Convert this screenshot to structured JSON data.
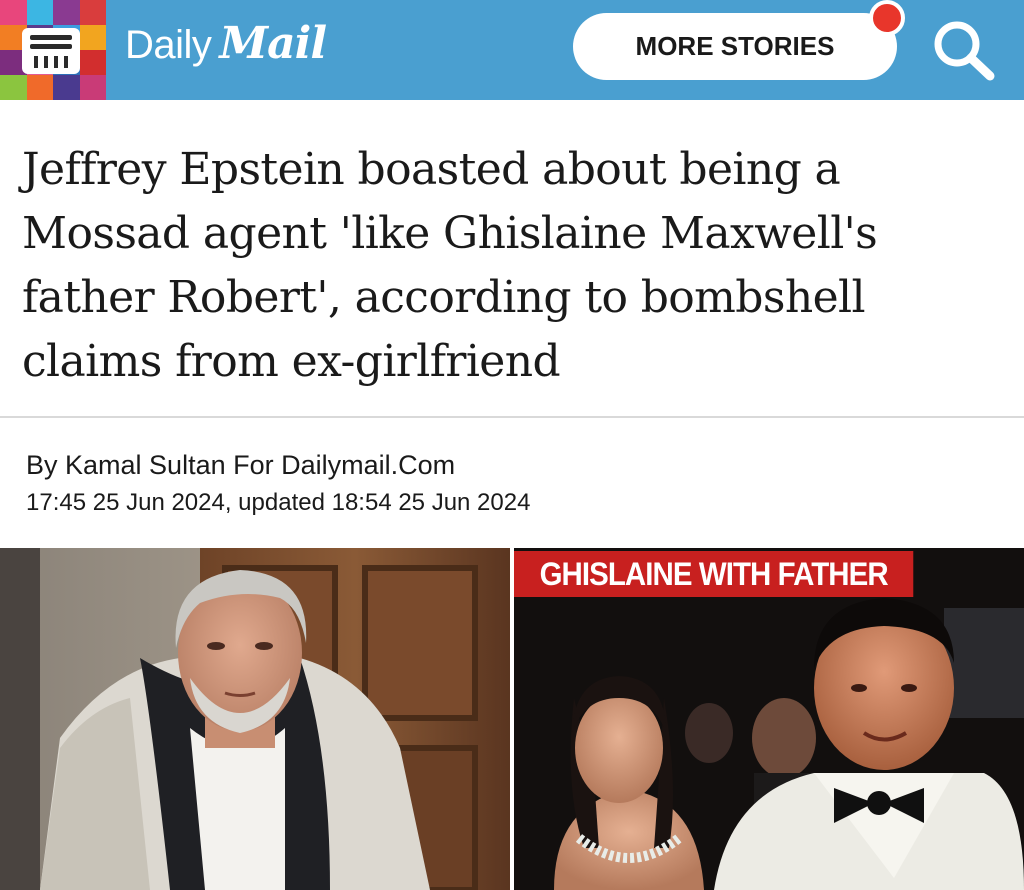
{
  "header": {
    "logo_daily": "Daily",
    "logo_mail": "Mail",
    "more_stories_label": "MORE STORIES",
    "menu_icon": "hamburger-menu-icon",
    "search_icon": "search-icon",
    "colors": {
      "header_bg": "#4a9fd0",
      "notification": "#e8362b",
      "menu_tiles": [
        "#e8467c",
        "#3cb6e3",
        "#8a3a91",
        "#d93d3d",
        "#f27e23",
        "#5b3b8c",
        "#3c9ee0",
        "#f2a51f",
        "#7c2d7e",
        "#e35a94",
        "#2e6fb8",
        "#d22e2e",
        "#8bc53f",
        "#f06a2a",
        "#4a3a8f",
        "#c93b77"
      ]
    }
  },
  "article": {
    "headline": "Jeffrey Epstein boasted about being a Mossad agent 'like Ghislaine Maxwell's father Robert', according to bombshell claims from ex-girlfriend",
    "byline": "By Kamal Sultan For Dailymail.Com",
    "timestamp": "17:45 25 Jun 2024, updated 18:54 25 Jun 2024"
  },
  "images": {
    "right_caption": "GHISLAINE WITH FATHER",
    "caption_color": "#c8201f"
  }
}
